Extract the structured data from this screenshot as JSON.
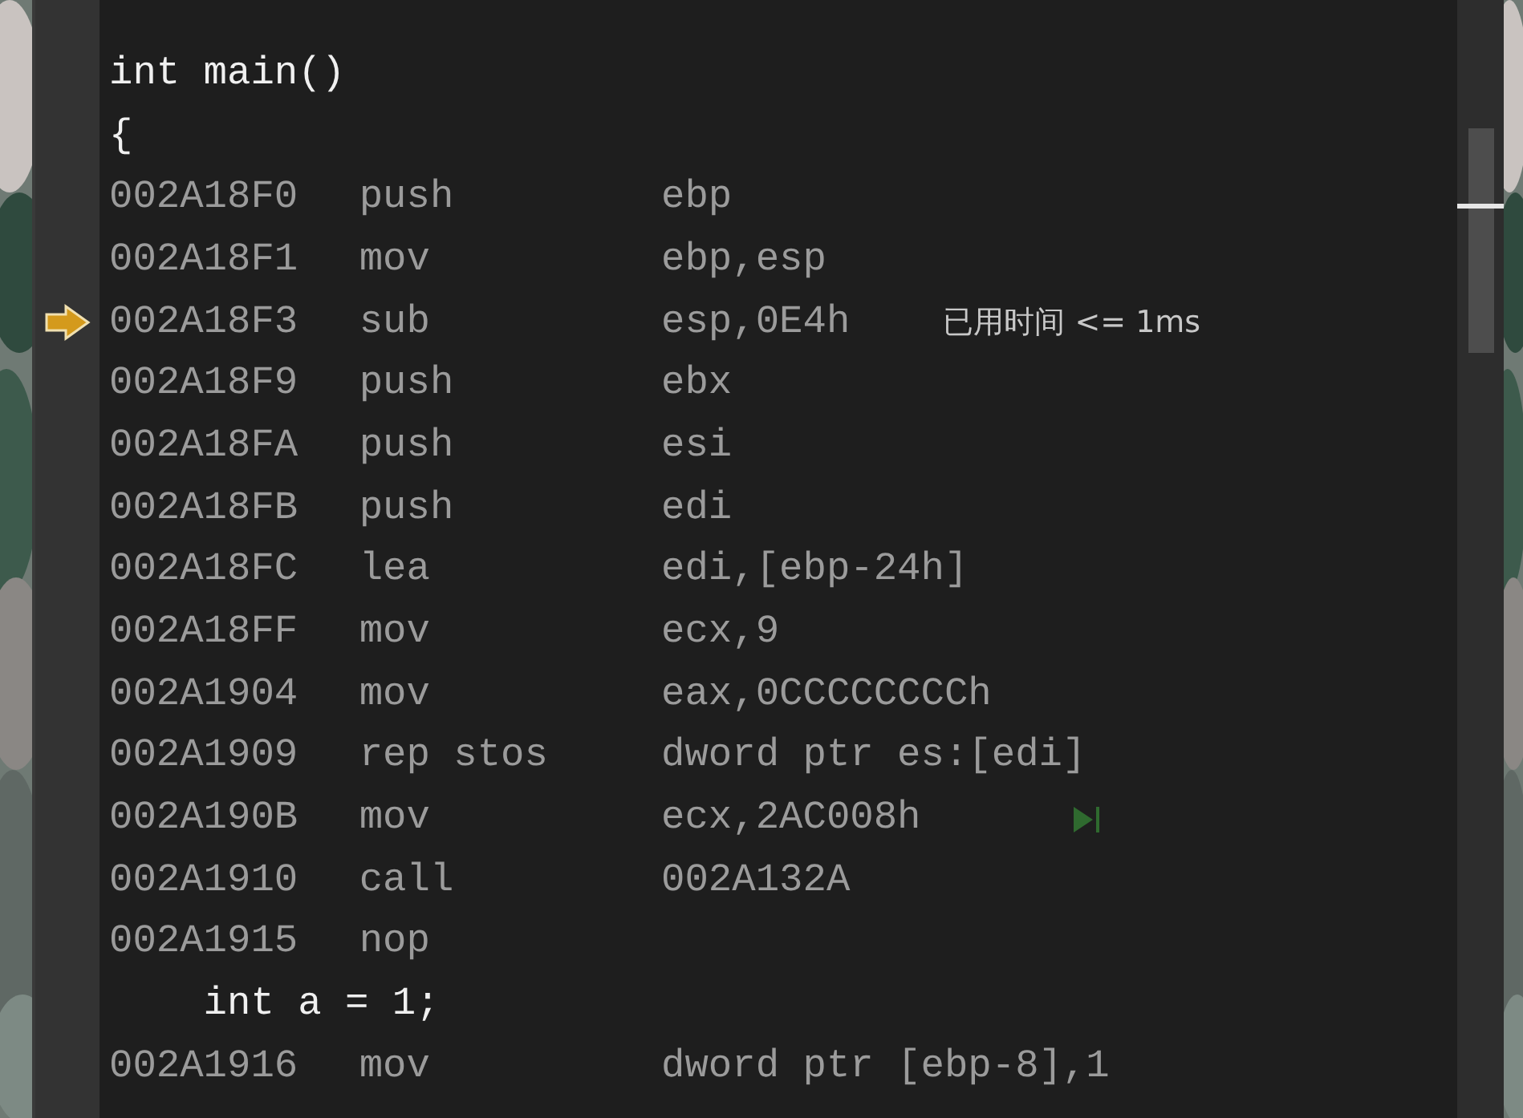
{
  "disassembly": {
    "lines": [
      {
        "kind": "source",
        "text": "int main()"
      },
      {
        "kind": "source",
        "text": "{"
      },
      {
        "kind": "asm",
        "address": "002A18F0",
        "mnemonic": "push",
        "operands": "ebp",
        "current": false,
        "run_to_here": false
      },
      {
        "kind": "asm",
        "address": "002A18F1",
        "mnemonic": "mov",
        "operands": "ebp,esp",
        "current": false,
        "run_to_here": false
      },
      {
        "kind": "asm",
        "address": "002A18F3",
        "mnemonic": "sub",
        "operands": "esp,0E4h",
        "current": true,
        "run_to_here": false,
        "elapsed": "已用时间 <= 1ms"
      },
      {
        "kind": "asm",
        "address": "002A18F9",
        "mnemonic": "push",
        "operands": "ebx",
        "current": false,
        "run_to_here": false
      },
      {
        "kind": "asm",
        "address": "002A18FA",
        "mnemonic": "push",
        "operands": "esi",
        "current": false,
        "run_to_here": false
      },
      {
        "kind": "asm",
        "address": "002A18FB",
        "mnemonic": "push",
        "operands": "edi",
        "current": false,
        "run_to_here": false
      },
      {
        "kind": "asm",
        "address": "002A18FC",
        "mnemonic": "lea",
        "operands": "edi,[ebp-24h]",
        "current": false,
        "run_to_here": false
      },
      {
        "kind": "asm",
        "address": "002A18FF",
        "mnemonic": "mov",
        "operands": "ecx,9",
        "current": false,
        "run_to_here": false
      },
      {
        "kind": "asm",
        "address": "002A1904",
        "mnemonic": "mov",
        "operands": "eax,0CCCCCCCCh",
        "current": false,
        "run_to_here": false
      },
      {
        "kind": "asm",
        "address": "002A1909",
        "mnemonic": "rep stos",
        "operands": "dword ptr es:[edi]",
        "current": false,
        "run_to_here": false
      },
      {
        "kind": "asm",
        "address": "002A190B",
        "mnemonic": "mov",
        "operands": "ecx,2AC008h",
        "current": false,
        "run_to_here": true
      },
      {
        "kind": "asm",
        "address": "002A1910",
        "mnemonic": "call",
        "operands": "002A132A",
        "current": false,
        "run_to_here": false
      },
      {
        "kind": "asm",
        "address": "002A1915",
        "mnemonic": "nop",
        "current": false,
        "run_to_here": false
      },
      {
        "kind": "source",
        "text": "    int a = 1;"
      },
      {
        "kind": "asm",
        "address": "002A1916",
        "mnemonic": "mov",
        "operands": "dword ptr [ebp-8],1",
        "current": false,
        "run_to_here": false
      }
    ]
  }
}
